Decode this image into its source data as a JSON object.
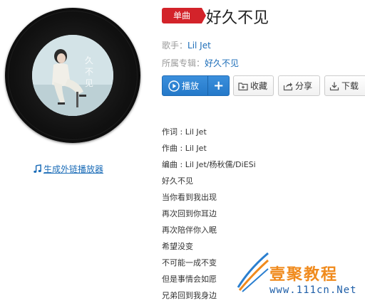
{
  "header": {
    "badge": "单曲",
    "song_title": "好久不见"
  },
  "meta": {
    "singer_label": "歌手：",
    "singer": "Lil Jet",
    "album_label": "所属专辑：",
    "album": "好久不见"
  },
  "buttons": {
    "play": "播放",
    "add": "+",
    "favorite": "收藏",
    "share": "分享",
    "download": "下载"
  },
  "player_link": "生成外链播放器",
  "lyrics": [
    "作词 : Lil Jet",
    "作曲 : Lil Jet",
    "编曲 : Lil Jet/杨秋儒/DiESi",
    "好久不见",
    "当你看到我出现",
    "再次回到你耳边",
    "再次陪伴你入眠",
    "希望没变",
    "不可能一成不变",
    "但是事情会如愿",
    "兄弟回到我身边"
  ],
  "watermark": {
    "brand": "壹聚教程",
    "url": "www.111cn.Net"
  },
  "colors": {
    "accent_blue": "#2479c9",
    "badge_red": "#d3232a",
    "link_blue": "#1c6db8",
    "watermark_orange": "#f08a1c"
  }
}
